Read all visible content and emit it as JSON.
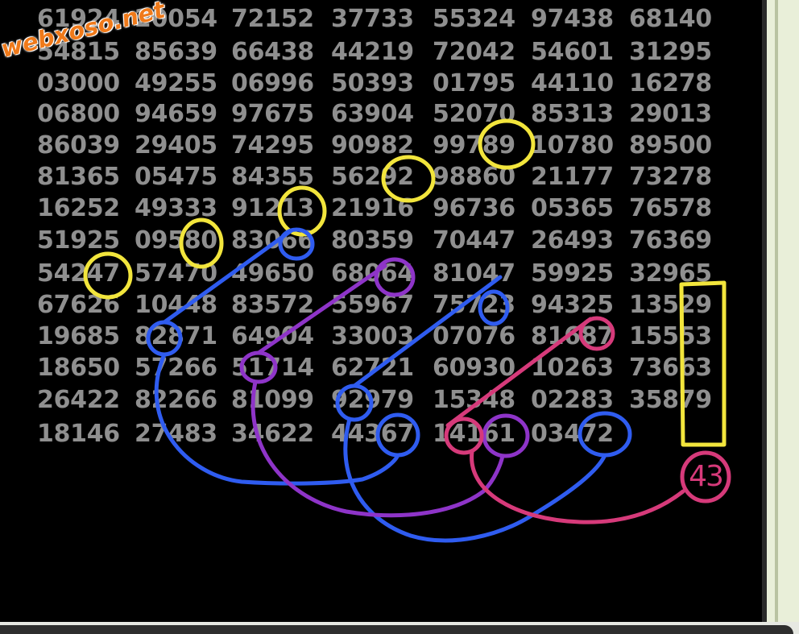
{
  "watermark": "webxoso.net",
  "grid": {
    "rows": [
      [
        "61924",
        "20054",
        "72152",
        "37733",
        "55324",
        "97438",
        "68140"
      ],
      [
        "54815",
        "85639",
        "66438",
        "44219",
        "72042",
        "54601",
        "31295"
      ],
      [
        "03000",
        "49255",
        "06996",
        "50393",
        "01795",
        "44110",
        "16278"
      ],
      [
        "06800",
        "94659",
        "97675",
        "63904",
        "52070",
        "85313",
        "29013"
      ],
      [
        "86039",
        "29405",
        "74295",
        "90982",
        "99789",
        "10780",
        "89500"
      ],
      [
        "81365",
        "05475",
        "84355",
        "56292",
        "98860",
        "21177",
        "73278"
      ],
      [
        "16252",
        "49333",
        "91213",
        "21916",
        "96736",
        "05365",
        "76578"
      ],
      [
        "51925",
        "09580",
        "83066",
        "80359",
        "70447",
        "26493",
        "76369"
      ],
      [
        "54247",
        "57470",
        "49650",
        "68064",
        "81047",
        "59925",
        "32965"
      ],
      [
        "67626",
        "10448",
        "83572",
        "55967",
        "75723",
        "94325",
        "13529"
      ],
      [
        "19685",
        "82871",
        "64904",
        "33003",
        "07076",
        "81687",
        "15553"
      ],
      [
        "18650",
        "57266",
        "51714",
        "62721",
        "60930",
        "10263",
        "73663"
      ],
      [
        "26422",
        "82266",
        "81099",
        "92979",
        "15348",
        "02283",
        "35879"
      ],
      [
        "18146",
        "27483",
        "34622",
        "44367",
        "14161",
        "03472",
        ""
      ]
    ]
  },
  "annotation_colors": {
    "yellow": "#f2e53c",
    "blue": "#2f5cf0",
    "purple": "#8e34c8",
    "pink": "#d63a7a"
  },
  "answer": "43"
}
